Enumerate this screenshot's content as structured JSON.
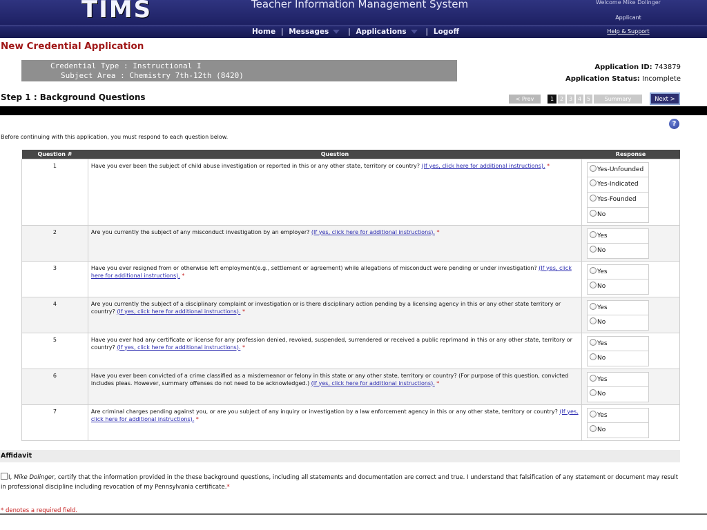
{
  "header": {
    "logo": "TIMS",
    "system_title": "Teacher Information Management System",
    "welcome": "Welcome Mike Dolinger",
    "role": "Applicant",
    "nav": {
      "home": "Home",
      "messages": "Messages",
      "applications": "Applications",
      "logoff": "Logoff",
      "separator": "|"
    },
    "help": "Help & Support"
  },
  "page": {
    "title": "New Credential Application",
    "credential_type": "Credential Type : Instructional I",
    "subject_area": "Subject Area : Chemistry 7th-12th (8420)",
    "app_id_label": "Application ID:",
    "app_id": "743879",
    "app_status_label": "Application Status:",
    "app_status": "Incomplete"
  },
  "steps": {
    "title": "Step 1 : Background Questions",
    "prev": "< Prev",
    "items": [
      "1",
      "2",
      "3",
      "4",
      "5",
      "Summary"
    ],
    "next": "Next >"
  },
  "intro": "Before continuing with this application, you must respond to each question below.",
  "help_icon": "?",
  "table": {
    "headers": [
      "Question #",
      "Question",
      "Response"
    ],
    "link_text": "(If yes, click here for additional instructions).",
    "required_mark": "*",
    "rows": [
      {
        "num": "1",
        "text": "Have you ever been the subject of child abuse investigation or reported in this or any other state, territory or country?",
        "options": [
          "Yes-Unfounded",
          "Yes-Indicated",
          "Yes-Founded",
          "No"
        ]
      },
      {
        "num": "2",
        "text": "Are you currently the subject of any misconduct investigation by an employer?",
        "options": [
          "Yes",
          "No"
        ]
      },
      {
        "num": "3",
        "text": "Have you ever resigned from or otherwise left employment(e.g., settlement or agreement) while allegations of misconduct were pending or under investigation?",
        "options": [
          "Yes",
          "No"
        ]
      },
      {
        "num": "4",
        "text": "Are you currently the subject of a disciplinary complaint or investigation or is there disciplinary action pending by a licensing agency in this or any other state territory or country?",
        "options": [
          "Yes",
          "No"
        ]
      },
      {
        "num": "5",
        "text": "Have you ever had any certificate or license for any profession denied, revoked, suspended, surrendered or received a public reprimand in this or any other state, territory or country?",
        "options": [
          "Yes",
          "No"
        ]
      },
      {
        "num": "6",
        "text": "Have you ever been convicted of a crime classified as a misdemeanor or felony in this state or any other state, territory or country? (For purpose of this question, convicted includes pleas. However, summary offenses do not need to be acknowledged.)",
        "options": [
          "Yes",
          "No"
        ]
      },
      {
        "num": "7",
        "text": "Are criminal charges pending against you, or are you subject of any inquiry or investigation by a law enforcement agency in this or any other state, territory or country?",
        "options": [
          "Yes",
          "No"
        ]
      }
    ]
  },
  "affidavit": {
    "title": "Affidavit",
    "prefix": "I, ",
    "name": "Mike Dolinger",
    "text": ", certify that the information provided in the these background questions, including all statements and documentation are correct and true. I understand that falsification of any statement or document may result in professional discipline including revocation of my Pennsylvania certificate.",
    "required_mark": "*"
  },
  "footnote": "* denotes a required field."
}
